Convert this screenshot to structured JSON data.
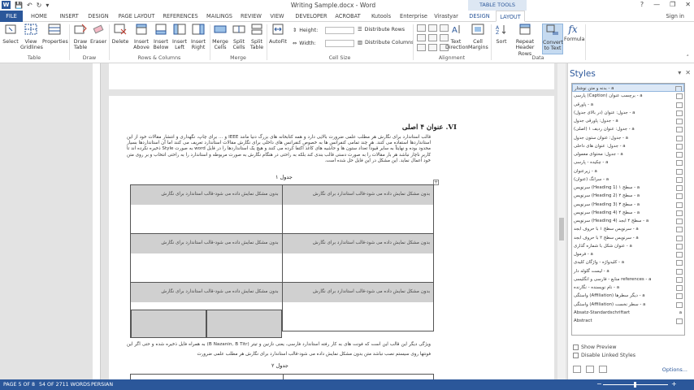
{
  "titlebar": {
    "app_icon": "W",
    "title": "Writing Sample.docx - Word",
    "context_group": "TABLE TOOLS",
    "help": "?",
    "minimize": "—",
    "restore": "❐",
    "close": "✕"
  },
  "tabs": [
    {
      "label": "FILE"
    },
    {
      "label": "HOME"
    },
    {
      "label": "INSERT"
    },
    {
      "label": "DESIGN"
    },
    {
      "label": "PAGE LAYOUT"
    },
    {
      "label": "REFERENCES"
    },
    {
      "label": "MAILINGS"
    },
    {
      "label": "REVIEW"
    },
    {
      "label": "VIEW"
    },
    {
      "label": "DEVELOPER"
    },
    {
      "label": "ACROBAT"
    },
    {
      "label": "Kutools"
    },
    {
      "label": "Enterprise"
    },
    {
      "label": "Virastyar"
    },
    {
      "label": "DESIGN"
    },
    {
      "label": "LAYOUT"
    }
  ],
  "signin": "Sign in",
  "ribbon": {
    "table": {
      "select": "Select",
      "view_gridlines": "View Gridlines",
      "properties": "Properties",
      "label": "Table"
    },
    "draw": {
      "draw_table": "Draw Table",
      "eraser": "Eraser",
      "label": "Draw"
    },
    "rows_columns": {
      "delete": "Delete",
      "insert_above": "Insert Above",
      "insert_below": "Insert Below",
      "insert_left": "Insert Left",
      "insert_right": "Insert Right",
      "label": "Rows & Columns"
    },
    "merge": {
      "merge_cells": "Merge Cells",
      "split_cells": "Split Cells",
      "split_table": "Split Table",
      "label": "Merge"
    },
    "cell_size": {
      "autofit": "AutoFit",
      "height": "Height:",
      "width": "Width:",
      "distribute_rows": "Distribute Rows",
      "distribute_columns": "Distribute Columns",
      "label": "Cell Size"
    },
    "alignment": {
      "text_direction": "Text Direction",
      "cell_margins": "Cell Margins",
      "label": "Alignment"
    },
    "data": {
      "sort": "Sort",
      "repeat_header_rows": "Repeat Header Rows",
      "convert_to_text": "Convert to Text",
      "formula": "Formula",
      "label": "Data"
    }
  },
  "document": {
    "heading": "VI. عنوان ۴ اصلی",
    "paragraph": "قالب استاندارد برای نگارش هر مطلب علمی ضرورت بالایی دارد و همه کتابخانه های بزرگ دنیا مانند IEEE و ... برای چاپ، نگهداری و انتشار مقالات خود از این استانداردها استفاده می کنند. هر چند تمامی کنفرانس ها به خصوص کنفرانس های داخلی برای نگارش مقالات استاندارد تعریف می کنند اما آن استانداردها بسیار محدود بوده و نهایتاً به سایر قیوداً تعداد ستون ها و حاشیه های کاغذ اکتفا کرده می کنند و هیچ یک استانداردها را در فایل word به صورت Style ذخیره نکرده اند تا کاربر ناچار نباشد هر بار مقالات را به صورت دستی قالب بندی کند بلکه به راحتی در هنگام نگارش به صورت مربوطه و استاندارد را به راحتی انتخاب و بر روی متن خود اعمال نماید. این مشکل در این فایل حل شده است.",
    "caption1": "جدول ۱",
    "cell_text": "بدون مشکل نمایش داده می شود-قالب استاندارد برای نگارش",
    "paragraph2": "ویژگی دیگر این قالب این است که فونت های به کار رفته استاندارد فارسی، یعنی نازنین و تیتر (B Nazanin, B Titr) به همراه فایل ذخیره شده و حتی اگر این فونتها روی سیستم نصب نباشد متن بدون مشکل نمایش داده می شود-قالب استاندارد برای نگارش هر مطلب علمی ضرورت",
    "caption2": "جدول ۲",
    "move_handle": "+"
  },
  "styles_pane": {
    "title": "Styles",
    "items": [
      {
        "label": "بدنه و متن نوشتار - a",
        "selected": true
      },
      {
        "label": "پارسی (Caption) برچسب عنوان - a"
      },
      {
        "label": "پاورقی - a"
      },
      {
        "label": "جدول: عنوان (در بالای جدول) - a"
      },
      {
        "label": "جدول: پاورقی جدول - a"
      },
      {
        "label": "جدول: عنوان ردیف ۱ (اصلی) - a"
      },
      {
        "label": "جدول: عنوان ستون جدول - a"
      },
      {
        "label": "جدول: عنوان های داخلی - a"
      },
      {
        "label": "جدول: محتوای معمولی - a"
      },
      {
        "label": "چکیده - پارسی - a"
      },
      {
        "label": "زیرعنوان - a"
      },
      {
        "label": "سرانگ (عنوان) - a"
      },
      {
        "label": "سرنویس (Heading 1) سطح ۱ - a"
      },
      {
        "label": "سرنویس (Heading 2) سطح ۲ - a"
      },
      {
        "label": "سرنویس (Heading 3) سطح ۳ - a"
      },
      {
        "label": "سرنویس (Heading 4) سطح ۴ - a"
      },
      {
        "label": "سرنویس (Heading 4) سطح ۴ ابجد - a"
      },
      {
        "label": "سرنویس سطح ۱ با حروف ابجد - a"
      },
      {
        "label": "سرنویس سطح ۲ با حروف ابجد - a"
      },
      {
        "label": "عنوان شکل با شماره گذاری - a"
      },
      {
        "label": "فرمول - a"
      },
      {
        "label": "کلیدواژه - واژگان کلیدی - a"
      },
      {
        "label": "لیست گلوله دار - a"
      },
      {
        "label": "منابع - فارسی و انگلیسی references - a"
      },
      {
        "label": "نام نویسنده - نگارنده - a"
      },
      {
        "label": "واستگی (Affiliation) دیگر سطرها - a"
      },
      {
        "label": "واستگی (Affiliation) سطر نخست - a"
      },
      {
        "label": "Absatz-Standardschriftart",
        "mark": "a"
      },
      {
        "label": "Abstract"
      }
    ],
    "show_preview": "Show Preview",
    "disable_linked": "Disable Linked Styles",
    "options": "Options..."
  },
  "statusbar": {
    "page": "PAGE 5 OF 8",
    "words": "54 OF 2711 WORDS",
    "language": "PERSIAN",
    "zoom_minus": "−",
    "zoom_plus": "+"
  },
  "colors": {
    "accent": "#2b579a",
    "context_tab": "#dde7f3",
    "cell_shade": "#d0d0d0"
  }
}
